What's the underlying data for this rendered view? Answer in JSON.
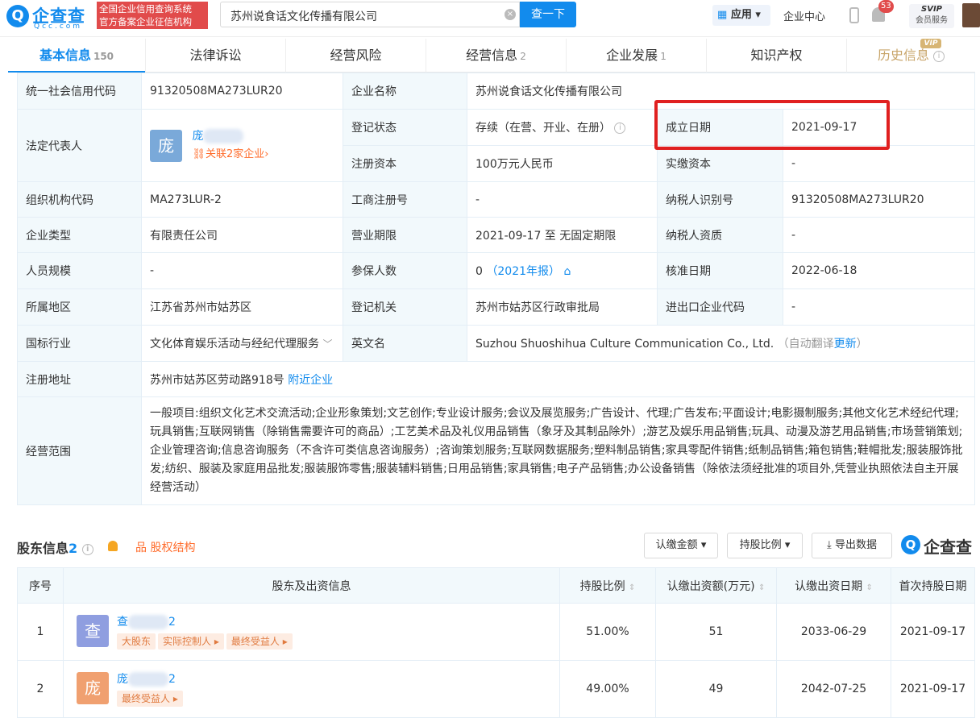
{
  "header": {
    "logo_text": "企查查",
    "logo_sub": "Qcc.com",
    "badge_line1": "全国企业信用查询系统",
    "badge_line2": "官方备案企业征信机构",
    "search_value": "苏州说食话文化传播有限公司",
    "search_button": "查一下",
    "app_label": "应用",
    "center_link": "企业中心",
    "notif_count": "53",
    "svip_top": "SVIP",
    "svip_bottom": "会员服务"
  },
  "tabs": [
    {
      "label": "基本信息",
      "count": "150"
    },
    {
      "label": "法律诉讼",
      "count": ""
    },
    {
      "label": "经营风险",
      "count": ""
    },
    {
      "label": "经营信息",
      "count": "2"
    },
    {
      "label": "企业发展",
      "count": "1"
    },
    {
      "label": "知识产权",
      "count": ""
    },
    {
      "label": "历史信息",
      "count": ""
    }
  ],
  "vip_tag": "VIP",
  "info": {
    "credit_code_label": "统一社会信用代码",
    "credit_code": "91320508MA273LUR20",
    "company_name_label": "企业名称",
    "company_name": "苏州说食话文化传播有限公司",
    "legal_rep_label": "法定代表人",
    "legal_rep_avatar": "庞",
    "legal_rep_name": "庞",
    "legal_rep_related": "关联2家企业",
    "reg_status_label": "登记状态",
    "reg_status": "存续（在营、开业、在册）",
    "established_label": "成立日期",
    "established": "2021-09-17",
    "reg_capital_label": "注册资本",
    "reg_capital": "100万元人民币",
    "paid_capital_label": "实缴资本",
    "paid_capital": "-",
    "org_code_label": "组织机构代码",
    "org_code": "MA273LUR-2",
    "biz_reg_no_label": "工商注册号",
    "biz_reg_no": "-",
    "taxpayer_id_label": "纳税人识别号",
    "taxpayer_id": "91320508MA273LUR20",
    "type_label": "企业类型",
    "type": "有限责任公司",
    "term_label": "营业期限",
    "term": "2021-09-17 至 无固定期限",
    "taxpayer_qual_label": "纳税人资质",
    "taxpayer_qual": "-",
    "staff_label": "人员规模",
    "staff": "-",
    "insured_label": "参保人数",
    "insured": "0",
    "insured_report": "（2021年报）",
    "approved_label": "核准日期",
    "approved": "2022-06-18",
    "region_label": "所属地区",
    "region": "江苏省苏州市姑苏区",
    "authority_label": "登记机关",
    "authority": "苏州市姑苏区行政审批局",
    "ie_code_label": "进出口企业代码",
    "ie_code": "-",
    "industry_label": "国标行业",
    "industry": "文化体育娱乐活动与经纪代理服务",
    "english_label": "英文名",
    "english": "Suzhou Shuoshihua Culture Communication Co., Ltd.",
    "auto_translate": "（自动翻译",
    "update_link": "更新",
    "close_paren": "）",
    "address_label": "注册地址",
    "address": "苏州市姑苏区劳动路918号",
    "nearby_link": "附近企业",
    "scope_label": "经营范围",
    "scope": "一般项目:组织文化艺术交流活动;企业形象策划;文艺创作;专业设计服务;会议及展览服务;广告设计、代理;广告发布;平面设计;电影摄制服务;其他文化艺术经纪代理;玩具销售;互联网销售（除销售需要许可的商品）;工艺美术品及礼仪用品销售（象牙及其制品除外）;游艺及娱乐用品销售;玩具、动漫及游艺用品销售;市场营销策划;企业管理咨询;信息咨询服务（不含许可类信息咨询服务）;咨询策划服务;互联网数据服务;塑料制品销售;家具零配件销售;纸制品销售;箱包销售;鞋帽批发;服装服饰批发;纺织、服装及家庭用品批发;服装服饰零售;服装辅料销售;日用品销售;家具销售;电子产品销售;办公设备销售（除依法须经批准的项目外,凭营业执照依法自主开展经营活动）"
  },
  "shareholders": {
    "title": "股东信息",
    "count": "2",
    "equity_link": "股权结构",
    "btn_amount": "认缴金额",
    "btn_ratio": "持股比例",
    "btn_export": "导出数据",
    "logo": "企查查",
    "headers": [
      "序号",
      "股东及出资信息",
      "持股比例",
      "认缴出资额(万元)",
      "认缴出资日期",
      "首次持股日期"
    ],
    "rows": [
      {
        "no": "1",
        "avatar": "查",
        "avatar_color": "#8f9ee0",
        "name": "查",
        "name_suffix": "2",
        "tags": [
          "大股东",
          "实际控制人",
          "最终受益人"
        ],
        "ratio": "51.00%",
        "amount": "51",
        "sub_date": "2033-06-29",
        "first_date": "2021-09-17"
      },
      {
        "no": "2",
        "avatar": "庞",
        "avatar_color": "#f0a070",
        "name": "庞",
        "name_suffix": "2",
        "tags": [
          "最终受益人"
        ],
        "ratio": "49.00%",
        "amount": "49",
        "sub_date": "2042-07-25",
        "first_date": "2021-09-17"
      }
    ]
  },
  "colors": {
    "brand": "#128bed",
    "alert": "#e14b4b",
    "orange": "#ff6d2d"
  }
}
